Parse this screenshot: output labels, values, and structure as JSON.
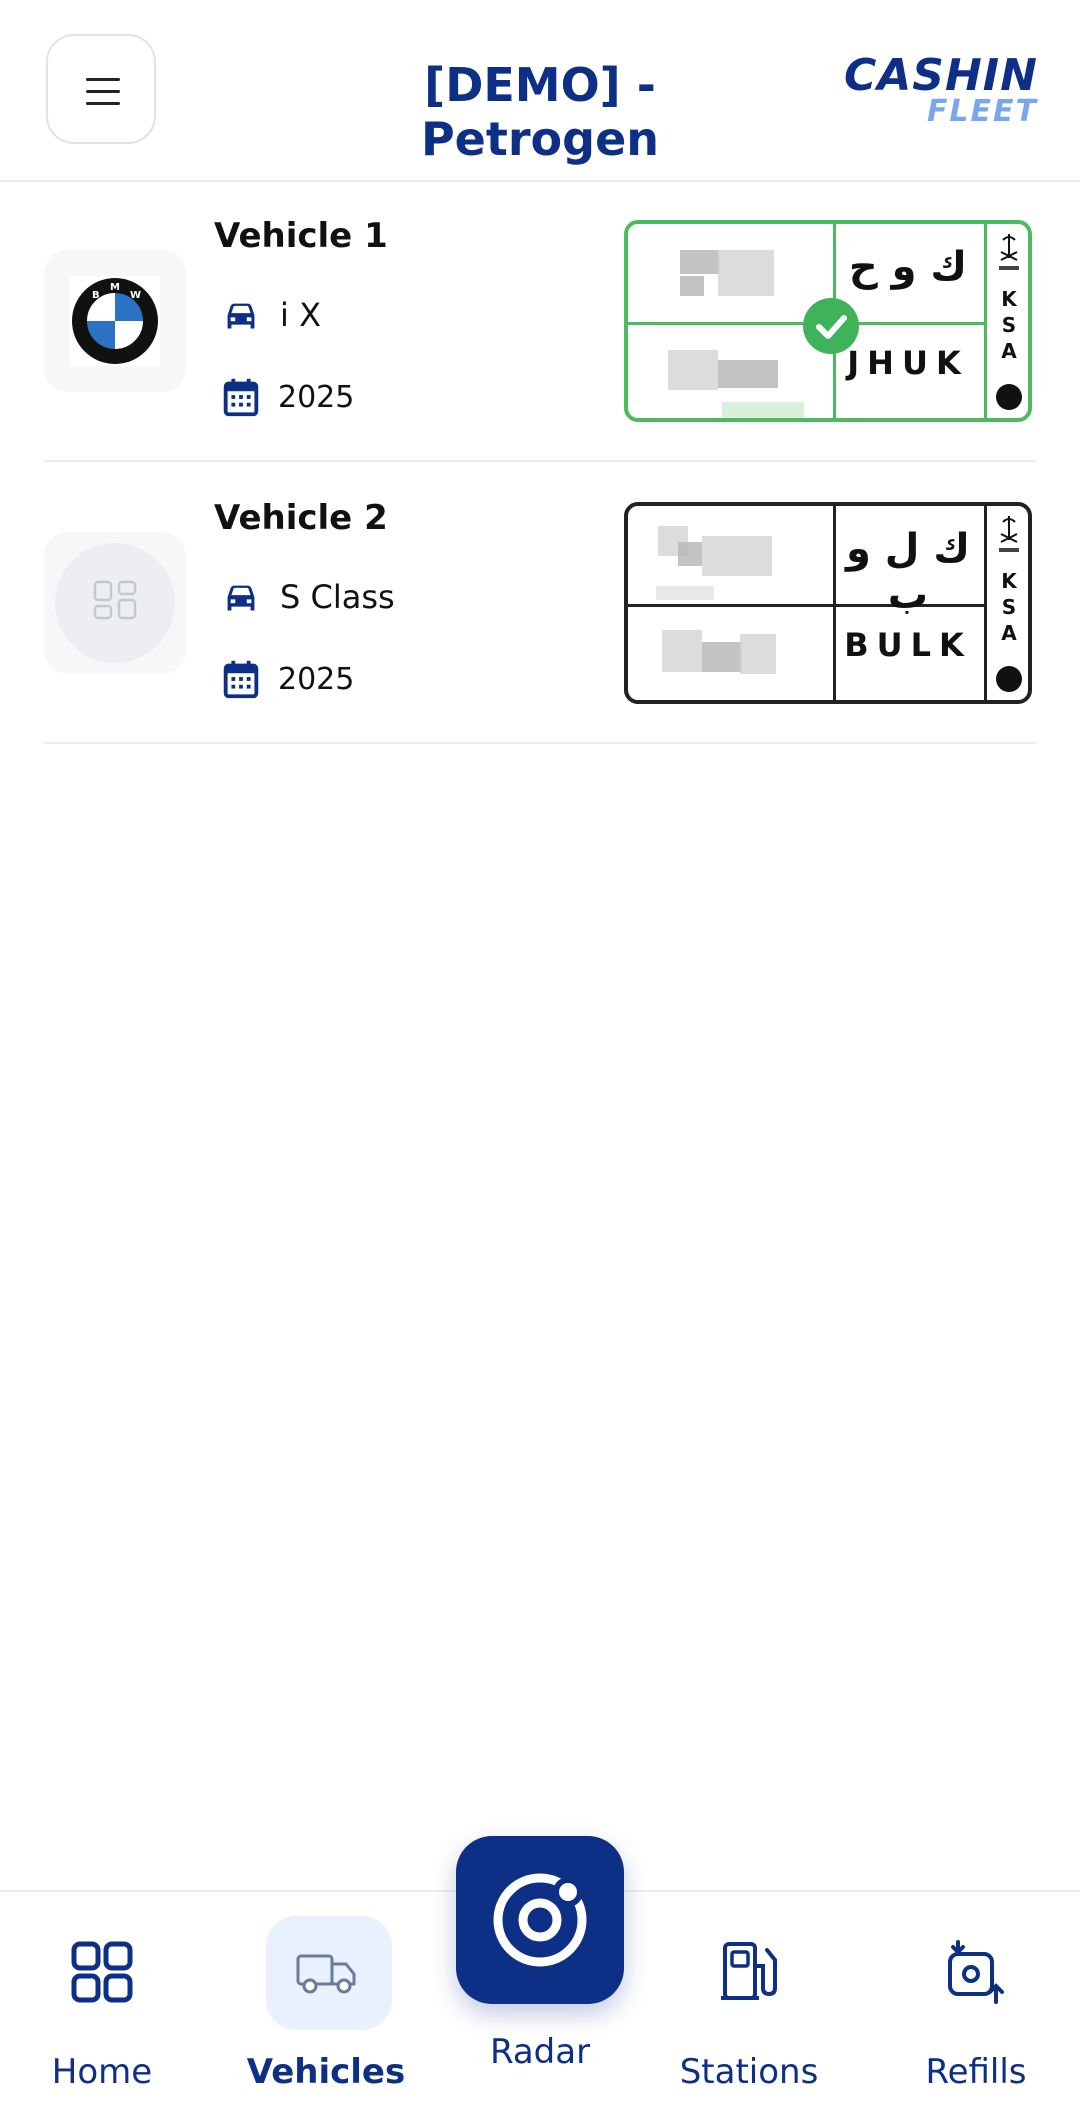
{
  "header": {
    "title": "[DEMO] - Petrogen",
    "logo_top": "CASHIN",
    "logo_bottom": "FLEET",
    "menu_icon": "hamburger-icon"
  },
  "vehicles": [
    {
      "name": "Vehicle 1",
      "model": "i X",
      "year": "2025",
      "brand_icon": "bmw-logo",
      "plate": {
        "arabic": "ك و ح",
        "latin": "JHUK",
        "country": [
          "K",
          "S",
          "A"
        ],
        "status": "verified",
        "border_color": "#4cba5f"
      }
    },
    {
      "name": "Vehicle 2",
      "model": "S Class",
      "year": "2025",
      "brand_icon": "placeholder-brand-icon",
      "plate": {
        "arabic": "ك ل و ب",
        "latin": "BULK",
        "country": [
          "K",
          "S",
          "A"
        ],
        "status": "none",
        "border_color": "#222222"
      }
    }
  ],
  "nav": {
    "items": [
      {
        "label": "Home",
        "icon": "home-grid-icon"
      },
      {
        "label": "Vehicles",
        "icon": "truck-icon",
        "active": true
      },
      {
        "label": "Radar",
        "icon": "radar-icon"
      },
      {
        "label": "Stations",
        "icon": "fuel-station-icon"
      },
      {
        "label": "Refills",
        "icon": "refill-icon"
      }
    ]
  },
  "colors": {
    "brand": "#0d2f86",
    "accent_light": "#7aa6ec",
    "success": "#3fb35a"
  }
}
